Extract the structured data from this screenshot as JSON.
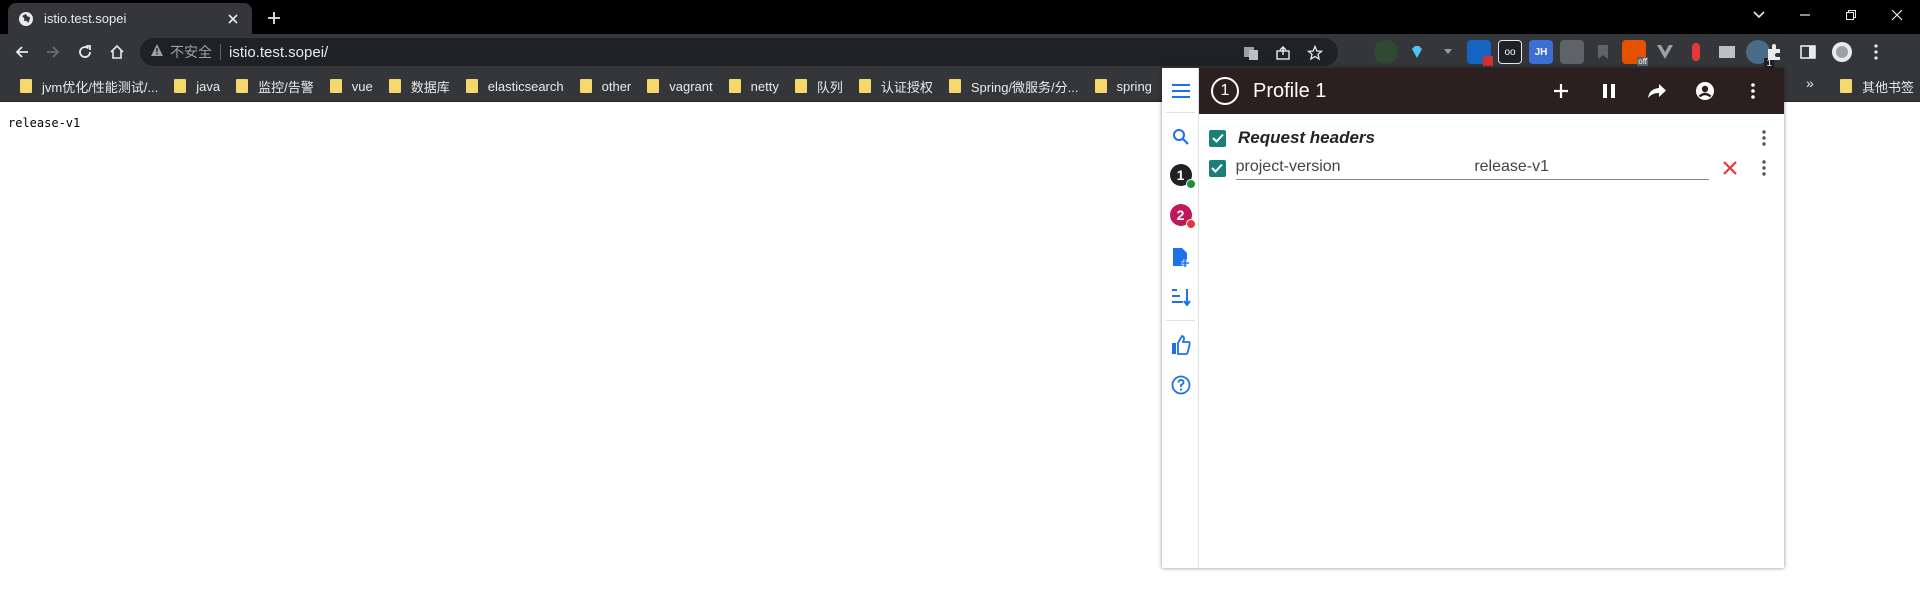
{
  "tab": {
    "title": "istio.test.sopei"
  },
  "omnibox": {
    "security_label": "不安全",
    "url": "istio.test.sopei/"
  },
  "bookmarks": {
    "items": [
      {
        "label": "jvm优化/性能测试/..."
      },
      {
        "label": "java"
      },
      {
        "label": "监控/告警"
      },
      {
        "label": "vue"
      },
      {
        "label": "数据库"
      },
      {
        "label": "elasticsearch"
      },
      {
        "label": "other"
      },
      {
        "label": "vagrant"
      },
      {
        "label": "netty"
      },
      {
        "label": "队列"
      },
      {
        "label": "认证授权"
      },
      {
        "label": "Spring/微服务/分..."
      },
      {
        "label": "spring"
      }
    ],
    "more": "»",
    "other_label": "其他书签"
  },
  "page": {
    "content": "release-v1"
  },
  "extensions": {
    "active_badge": "1"
  },
  "popup": {
    "profile_number": "1",
    "profile_title": "Profile 1",
    "side_profiles": [
      {
        "number": "1",
        "badge_color": "#202124",
        "dot_color": "#1e8e3e"
      },
      {
        "number": "2",
        "badge_color": "#c2185b",
        "dot_color": "#e53935"
      }
    ],
    "section_title": "Request headers",
    "headers": [
      {
        "name": "project-version",
        "value": "release-v1",
        "enabled": true
      }
    ]
  },
  "colors": {
    "accent": "#1a73e8",
    "checkbox": "#1a7f78",
    "delete": "#e53935",
    "header_bg": "#2b1f1f"
  }
}
